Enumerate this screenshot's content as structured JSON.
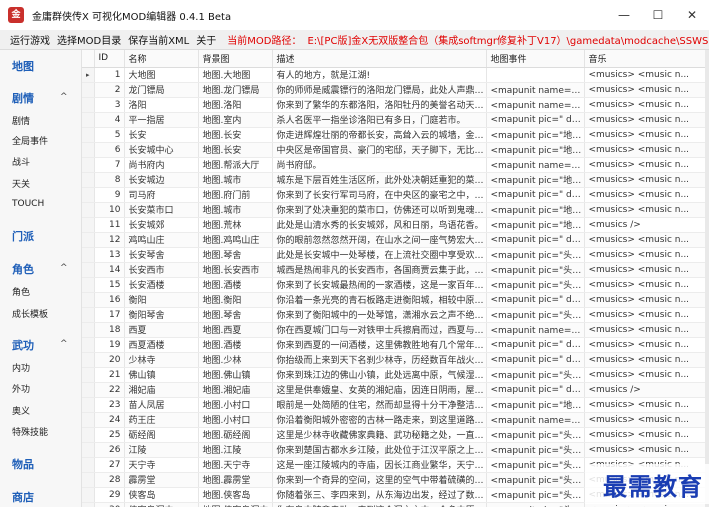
{
  "window": {
    "title": "金庸群侠传X 可视化MOD编辑器 0.4.1 Beta",
    "icon_label": "金",
    "min_glyph": "—",
    "max_glyph": "☐",
    "close_glyph": "✕"
  },
  "menu": {
    "items": [
      "运行游戏",
      "选择MOD目录",
      "保存当前XML",
      "关于"
    ],
    "mod_path_label": "当前MOD路径：",
    "mod_path": "E:\\[PC版]金X无双版整合包（集成softmgr修复补丁V17）\\gamedata\\modcache\\SSWS"
  },
  "sidebar": {
    "groups": [
      {
        "label": "地图",
        "expanded": null,
        "items": []
      },
      {
        "label": "剧情",
        "expanded": true,
        "items": [
          "剧情",
          "全局事件",
          "战斗",
          "天关",
          "TOUCH"
        ]
      },
      {
        "label": "门派",
        "expanded": null,
        "items": []
      },
      {
        "label": "角色",
        "expanded": true,
        "items": [
          "角色",
          "成长模板"
        ]
      },
      {
        "label": "武功",
        "expanded": true,
        "items": [
          "内功",
          "外功",
          "奥义",
          "特殊技能"
        ]
      },
      {
        "label": "物品",
        "expanded": null,
        "items": []
      },
      {
        "label": "商店",
        "expanded": null,
        "items": []
      }
    ],
    "chevron_glyph": "^"
  },
  "table": {
    "columns": [
      "ID",
      "名称",
      "背景图",
      "描述",
      "地图事件",
      "音乐"
    ],
    "current_row_marker": "▸",
    "rows": [
      [
        "1",
        "大地图",
        "地图.大地图",
        "有人的地方，就是江湖!",
        "",
        "<musics> <music n..."
      ],
      [
        "2",
        "龙门镖局",
        "地图.龙门镖局",
        "你的师师是威震镖行的洛阳龙门镖局，此处人声鼎沸...",
        "<mapunit name=\"镖...",
        "<musics> <music n..."
      ],
      [
        "3",
        "洛阳",
        "地图.洛阳",
        "你来到了繁华的东都洛阳，洛阳牡丹的美誉名动天下...",
        "<mapunit name=\"王...",
        "<musics> <music n..."
      ],
      [
        "4",
        "平一指居",
        "地图.室内",
        "杀人名医平一指坐诊洛阳已有多日，门庭若市。",
        "<mapunit pic=\" descr...",
        "<musics> <music n..."
      ],
      [
        "5",
        "长安",
        "地图.长安",
        "你走进辉煌壮丽的帝都长安，高耸入云的城墙，金碧...",
        "<mapunit pic=\"地图...",
        "<musics> <music n..."
      ],
      [
        "6",
        "长安城中心",
        "地图.长安",
        "中央区是帝国官员、豪门的宅邸，天子脚下，无比恢...",
        "<mapunit pic=\"地图...",
        "<musics> <music n..."
      ],
      [
        "7",
        "尚书府内",
        "地图.帮派大厅",
        "尚书府邸。",
        "<mapunit name=\"大...",
        "<musics> <music n..."
      ],
      [
        "8",
        "长安城边",
        "地图.城市",
        "城东是下层百姓生活区所，此外处决朝廷重犯的菜市...",
        "<mapunit pic=\"地图...",
        "<musics> <music n..."
      ],
      [
        "9",
        "司马府",
        "地图.府门前",
        "你来到了长安行军司马府，在中央区的豪宅之中，司...",
        "<mapunit pic=\" descr...",
        "<musics> <music n..."
      ],
      [
        "10",
        "长安菜市口",
        "地图.城市",
        "你来到了处决重犯的菜市口，仿佛还可以听到鬼魂的...",
        "<mapunit pic=\"地图...",
        "<musics> <music n..."
      ],
      [
        "11",
        "长安城郊",
        "地图.荒林",
        "此处是山清水秀的长安城郊，风和日丽，鸟语花香。",
        "<mapunit pic=\"地图...",
        "<musics />"
      ],
      [
        "12",
        "鸡鸣山庄",
        "地图.鸡鸣山庄",
        "你的眼前忽然忽然开阔，在山水之间一座气势宏大的...",
        "<mapunit pic=\" descr...",
        "<musics> <music n..."
      ],
      [
        "13",
        "长安琴舍",
        "地图.琴舍",
        "此处是长安城中一处琴楼，在上流社交圈中享受欢迎...",
        "<mapunit pic=\"头像...",
        "<musics> <music n..."
      ],
      [
        "14",
        "长安西市",
        "地图.长安西市",
        "城西是热闹非凡的长安西市，各国商贾云集于此，各...",
        "<mapunit pic=\"头像...",
        "<musics> <music n..."
      ],
      [
        "15",
        "长安酒楼",
        "地图.酒楼",
        "你来到了长安城最热闹的一家酒楼，这是一家百年老店...",
        "<mapunit pic=\"头像...",
        "<musics> <music n..."
      ],
      [
        "16",
        "衡阳",
        "地图.衡阳",
        "你沿着一条光亮的青石板路走进衡阳城，相较中原而...",
        "<mapunit pic=\" descr...",
        "<musics> <music n..."
      ],
      [
        "17",
        "衡阳琴舍",
        "地图.琴舍",
        "你来到了衡阳城中的一处琴馆，潇湘水云之声不绝如...",
        "<mapunit pic=\"头像...",
        "<musics> <music n..."
      ],
      [
        "18",
        "西夏",
        "地图.西夏",
        "你在西夏城门口与一对铁甲士兵擦肩而过，西夏与北...",
        "<mapunit name=\"西...",
        "<musics> <music n..."
      ],
      [
        "19",
        "西夏酒楼",
        "地图.酒楼",
        "你来到西夏的一间酒楼，这里佛教胜地有几个常年往...",
        "<mapunit pic=\" descr...",
        "<musics> <music n..."
      ],
      [
        "20",
        "少林寺",
        "地图.少林",
        "你抬级而上来到天下名刹少林寺，历经数百年战火而...",
        "<mapunit pic=\" descr...",
        "<musics> <music n..."
      ],
      [
        "21",
        "佛山镇",
        "地图.佛山镇",
        "你来到珠江边的佛山小镇，此处远离中原，气候湿热...",
        "<mapunit pic=\"头像...",
        "<musics> <music n..."
      ],
      [
        "22",
        "湘妃庙",
        "地图.湘妃庙",
        "这里是供奉娥皇、女英的湘妃庙，因连日阴雨，屋顶...",
        "<mapunit pic=\" descr...",
        "<musics />"
      ],
      [
        "23",
        "苗人凤居",
        "地图.小村口",
        "眼前是一处简陋的住宅，然而却显得十分干净整洁，...",
        "<mapunit pic=\"地图...",
        "<musics> <music n..."
      ],
      [
        "24",
        "药王庄",
        "地图.小村口",
        "你沿着衡阳城外密密的古林一路走来，到这里道路变...",
        "<mapunit name=\"程...",
        "<musics> <music n..."
      ],
      [
        "25",
        "砺经阁",
        "地图.砺经阁",
        "这里是少林寺收藏佛家典籍、武功秘籍之处，一直以...",
        "<mapunit pic=\"头像...",
        "<musics> <music n..."
      ],
      [
        "26",
        "江陵",
        "地图.江陵",
        "你来到楚国古都水乡江陵，此处位于江汉平原之上，...",
        "<mapunit pic=\"头像...",
        "<musics> <music n..."
      ],
      [
        "27",
        "天宁寺",
        "地图.天宁寺",
        "这是一座江陵城内的寺庙，因长江商业繁华，天宁寺...",
        "<mapunit pic=\"头像...",
        "<musics> <music n..."
      ],
      [
        "28",
        "霹雳堂",
        "地图.霹雳堂",
        "你来到一个奇异的空间，这里的空气中带着硫磺的味...",
        "<mapunit pic=\"头像...",
        "<musics> <music n..."
      ],
      [
        "29",
        "侠客岛",
        "地图.侠客岛",
        "你随着张三、李四来到，从东海边出发，经过了数天...",
        "<mapunit pic=\"头像...",
        "<musics> <music n..."
      ],
      [
        "30",
        "侠客岛洞内",
        "地图.侠客岛洞内",
        "你在岛中随意走动，来到这个洞穴之中，众多中原武...",
        "<mapunit pic=\"头像...",
        "<musics> <music n..."
      ]
    ]
  },
  "watermark": "最需教育",
  "colors": {
    "accent_blue": "#1f5fb8",
    "path_red": "#e00000",
    "watermark_blue": "#1a3db3"
  }
}
